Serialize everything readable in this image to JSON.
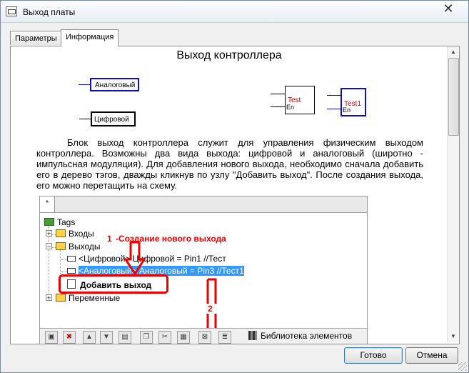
{
  "window": {
    "title": "Выход платы"
  },
  "tabs": [
    {
      "label": "Параметры"
    },
    {
      "label": "Информация"
    }
  ],
  "doc": {
    "title": "Выход  контроллера",
    "analog_label": "Аналоговый",
    "digital_label": "Цифровой",
    "block1_name": "Test",
    "block2_name": "Test1",
    "en_label": "En",
    "description": "Блок выход контроллера служит для управления физическим выходом контроллера. Возможны два вида выхода: цифровой и аналоговый (широтно - импульсная модуляция). Для добавления нового выхода, необходимо сначала добавить его в дерево тэгов, дважды кликнув по узлу \"Добавить выход\". После создания выхода, его можно перетащить на схему."
  },
  "shot": {
    "tab": "*",
    "tree": {
      "root": "Tags",
      "inputs": "Входы",
      "outputs": "Выходы",
      "item1": "<Цифровой> Цифровой = Pin1  //Тест",
      "item2": "<Аналоговый> Аналоговый = Pin3  //Тест1",
      "add": "Добавить выход",
      "vars": "Переменные"
    },
    "annotation1_num": "1",
    "annotation1_text": "-Создание нового выхода",
    "annotation2_num": "2",
    "library_label": "Библиотека элементов"
  },
  "buttons": {
    "ok": "Готово",
    "cancel": "Отмена"
  },
  "colors": {
    "annotation": "#e00000",
    "selection": "#3399ff",
    "block_border": "#1010c0"
  }
}
